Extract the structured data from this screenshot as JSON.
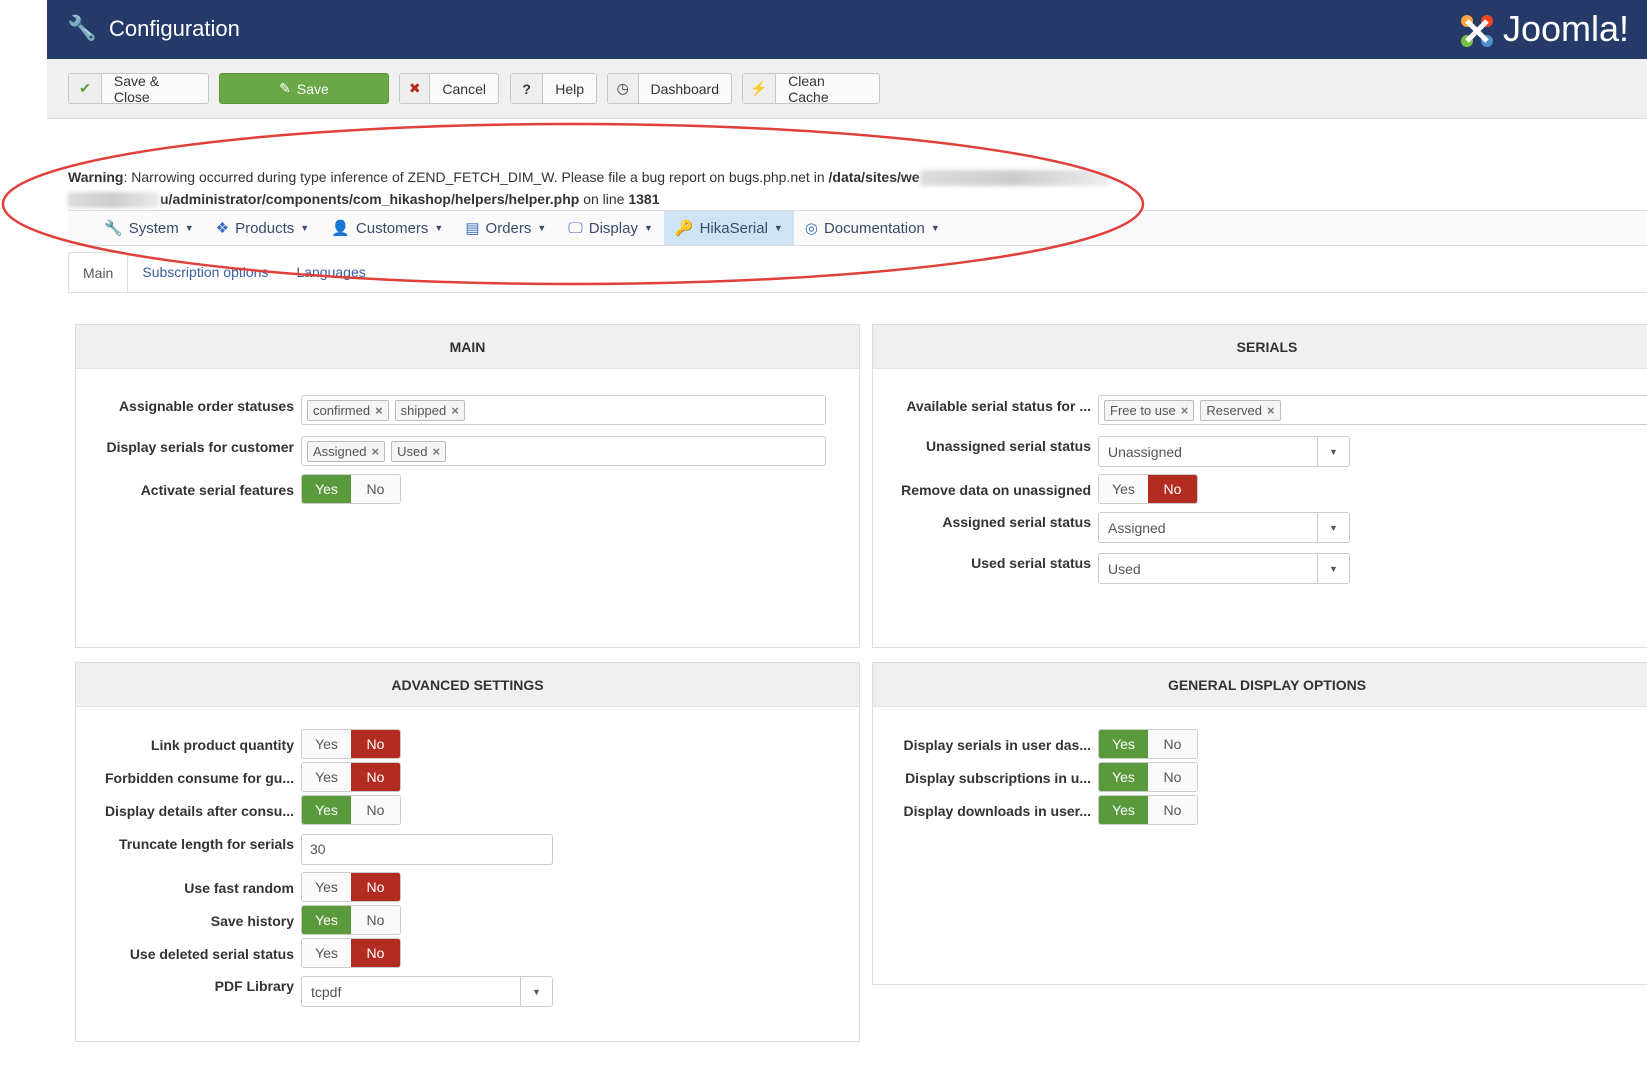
{
  "header": {
    "title": "Configuration",
    "logo_text": "Joomla!"
  },
  "toolbar": [
    {
      "label": "Save & Close",
      "icon": "✔"
    },
    {
      "label": "Save",
      "icon": "✎"
    },
    {
      "label": "Cancel",
      "icon": "✖"
    },
    {
      "label": "Help",
      "icon": "?"
    },
    {
      "label": "Dashboard",
      "icon": "◷"
    },
    {
      "label": "Clean Cache",
      "icon": "⚡"
    }
  ],
  "warning": {
    "label": "Warning",
    "text": ": Narrowing occurred during type inference of ZEND_FETCH_DIM_W. Please file a bug report on bugs.php.net in ",
    "path1": "/data/sites/we",
    "path2": "u/administrator/components/com_hikashop/helpers/helper.php",
    "on_line": " on line ",
    "line": "1381"
  },
  "submenu": [
    {
      "label": "System",
      "icon": "🔧"
    },
    {
      "label": "Products",
      "icon": "❖"
    },
    {
      "label": "Customers",
      "icon": "👤"
    },
    {
      "label": "Orders",
      "icon": "▤"
    },
    {
      "label": "Display",
      "icon": "🖵"
    },
    {
      "label": "HikaSerial",
      "icon": "🔑",
      "active": true
    },
    {
      "label": "Documentation",
      "icon": "◎"
    }
  ],
  "tabs": [
    {
      "label": "Main",
      "active": true
    },
    {
      "label": "Subscription options"
    },
    {
      "label": "Languages"
    }
  ],
  "panels": {
    "main": {
      "title": "MAIN",
      "rows": [
        {
          "label": "Assignable order statuses",
          "type": "tags",
          "tags": [
            "confirmed",
            "shipped"
          ]
        },
        {
          "label": "Display serials for customer",
          "type": "tags",
          "tags": [
            "Assigned",
            "Used"
          ]
        },
        {
          "label": "Activate serial features",
          "type": "toggle",
          "yes": "Yes",
          "no": "No",
          "value": "yes"
        }
      ]
    },
    "serials": {
      "title": "SERIALS",
      "rows": [
        {
          "label": "Available serial status for ...",
          "type": "tags",
          "tags": [
            "Free to use",
            "Reserved"
          ]
        },
        {
          "label": "Unassigned serial status",
          "type": "select",
          "value": "Unassigned"
        },
        {
          "label": "Remove data on unassigned",
          "type": "toggle",
          "yes": "Yes",
          "no": "No",
          "value": "no"
        },
        {
          "label": "Assigned serial status",
          "type": "select",
          "value": "Assigned"
        },
        {
          "label": "Used serial status",
          "type": "select",
          "value": "Used"
        }
      ]
    },
    "advanced": {
      "title": "ADVANCED SETTINGS",
      "rows": [
        {
          "label": "Link product quantity",
          "type": "toggle",
          "yes": "Yes",
          "no": "No",
          "value": "no"
        },
        {
          "label": "Forbidden consume for gu...",
          "type": "toggle",
          "yes": "Yes",
          "no": "No",
          "value": "no"
        },
        {
          "label": "Display details after consu...",
          "type": "toggle",
          "yes": "Yes",
          "no": "No",
          "value": "yes"
        },
        {
          "label": "Truncate length for serials",
          "type": "input",
          "value": "30"
        },
        {
          "label": "Use fast random",
          "type": "toggle",
          "yes": "Yes",
          "no": "No",
          "value": "no"
        },
        {
          "label": "Save history",
          "type": "toggle",
          "yes": "Yes",
          "no": "No",
          "value": "yes"
        },
        {
          "label": "Use deleted serial status",
          "type": "toggle",
          "yes": "Yes",
          "no": "No",
          "value": "no"
        },
        {
          "label": "PDF Library",
          "type": "select",
          "value": "tcpdf"
        }
      ]
    },
    "general": {
      "title": "GENERAL DISPLAY OPTIONS",
      "rows": [
        {
          "label": "Display serials in user das...",
          "type": "toggle",
          "yes": "Yes",
          "no": "No",
          "value": "yes"
        },
        {
          "label": "Display subscriptions in u...",
          "type": "toggle",
          "yes": "Yes",
          "no": "No",
          "value": "yes"
        },
        {
          "label": "Display downloads in user...",
          "type": "toggle",
          "yes": "Yes",
          "no": "No",
          "value": "yes"
        }
      ]
    }
  }
}
